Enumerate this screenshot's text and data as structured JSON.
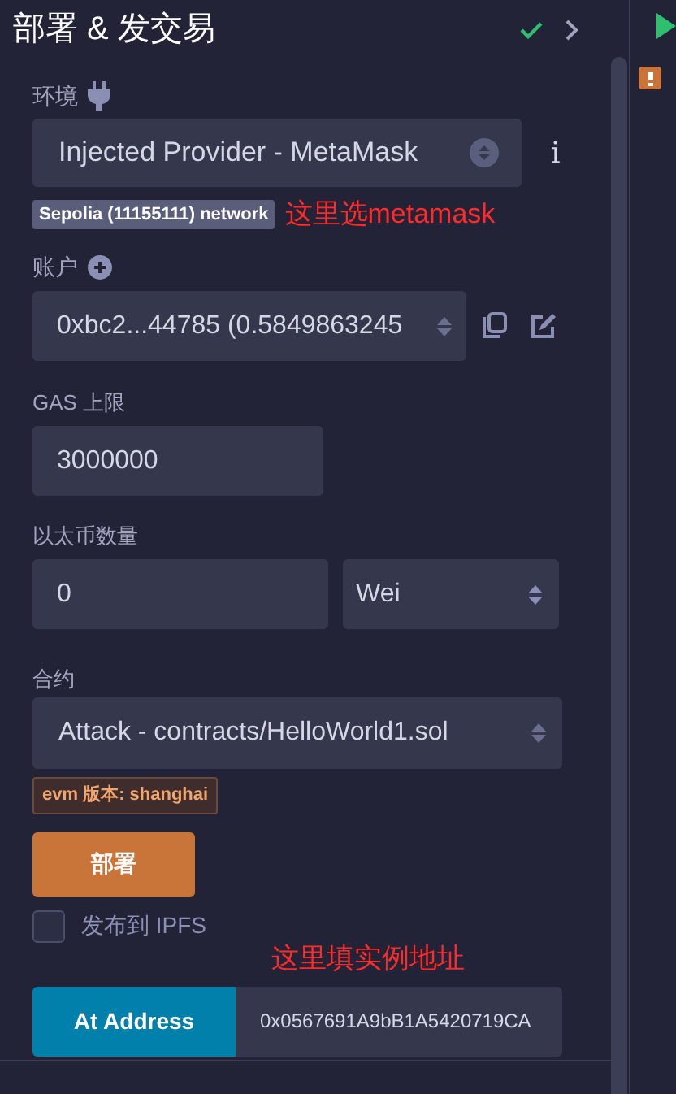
{
  "panel": {
    "title": "部署 & 发交易"
  },
  "environment": {
    "label": "环境",
    "value": "Injected Provider - MetaMask",
    "info": "i",
    "network_badge": "Sepolia (11155111) network"
  },
  "account": {
    "label": "账户",
    "value": "0xbc2...44785 (0.5849863245"
  },
  "gas_limit": {
    "label": "GAS 上限",
    "value": "3000000"
  },
  "value": {
    "label": "以太币数量",
    "amount": "0",
    "unit": "Wei"
  },
  "contract": {
    "label": "合约",
    "value": "Attack - contracts/HelloWorld1.sol",
    "evm_badge": "evm 版本: shanghai"
  },
  "deploy_button": "部署",
  "publish_ipfs": {
    "label": "发布到 IPFS",
    "checked": false
  },
  "at_address": {
    "button": "At Address",
    "value": "0x0567691A9bB1A5420719CA"
  },
  "annotations": [
    {
      "text": "这里选metamask"
    },
    {
      "text": "这里填实例地址"
    }
  ]
}
